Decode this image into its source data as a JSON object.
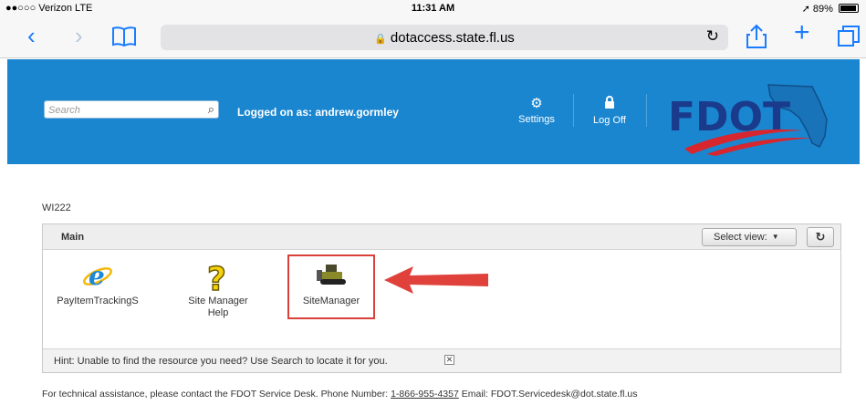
{
  "status_bar": {
    "carrier": "●●○○○ Verizon  LTE",
    "time": "11:31 AM",
    "battery": "89%"
  },
  "browser": {
    "url": "dotaccess.state.fl.us"
  },
  "header": {
    "search_placeholder": "Search",
    "logged_on": "Logged on as: andrew.gormley",
    "settings_label": "Settings",
    "logoff_label": "Log Off",
    "logo_text": "FDOT",
    "colors": {
      "header_bg": "#1a86d0",
      "logo_red": "#d7262e",
      "logo_navy": "#1a3b8c"
    }
  },
  "workspace": {
    "label": "WI222"
  },
  "panel": {
    "title": "Main",
    "select_view_label": "Select view:",
    "apps": [
      {
        "name": "PayItemTrackingS",
        "icon": "internet-explorer-icon"
      },
      {
        "name_line1": "Site Manager",
        "name_line2": "Help",
        "icon": "help-question-icon"
      },
      {
        "name": "SiteManager",
        "icon": "bulldozer-icon"
      }
    ],
    "hint": "Hint: Unable to find the resource you need? Use Search to locate it for you."
  },
  "footer": {
    "prefix": "For technical assistance, please contact the FDOT Service Desk. Phone Number:",
    "phone": "1-866-955-4357",
    "email_prefix": "Email:",
    "email": "FDOT.Servicedesk@dot.state.fl.us"
  }
}
